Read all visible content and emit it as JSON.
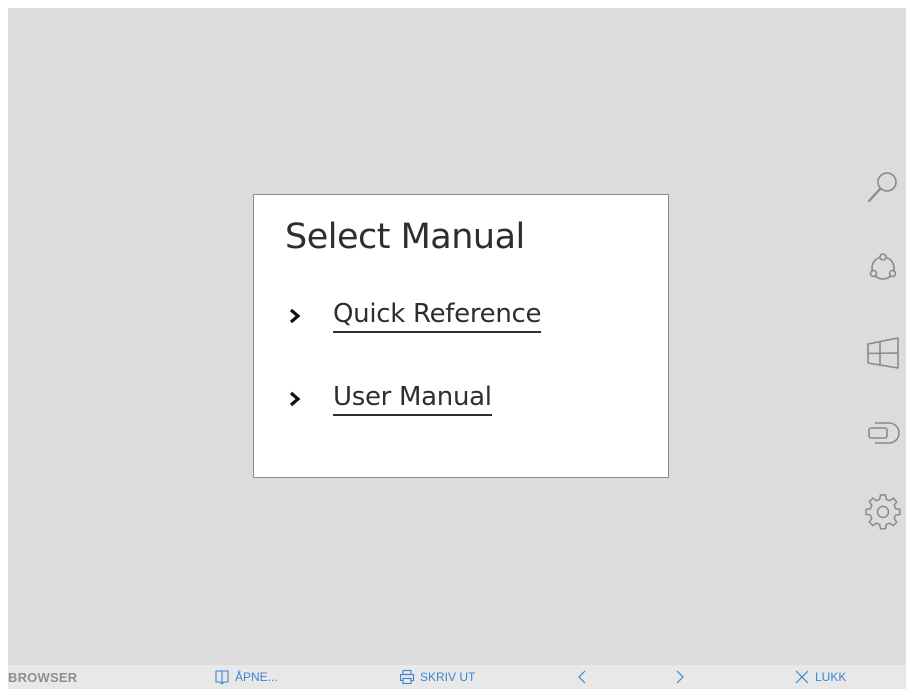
{
  "dialog": {
    "title": "Select Manual",
    "items": [
      {
        "label": "Quick Reference"
      },
      {
        "label": "User Manual"
      }
    ]
  },
  "side_toolbar": {
    "icons": [
      "search-icon",
      "share-icon",
      "windows-icon",
      "input-source-icon",
      "settings-icon"
    ]
  },
  "bottom_bar": {
    "app_label": "BROWSER",
    "open_label": "ÅPNE...",
    "print_label": "SKRIV UT",
    "close_label": "LUKK"
  },
  "colors": {
    "background": "#dcdcdc",
    "accent": "#3a86d0",
    "text": "#2e2e2e",
    "icon": "#8a8a8a"
  }
}
